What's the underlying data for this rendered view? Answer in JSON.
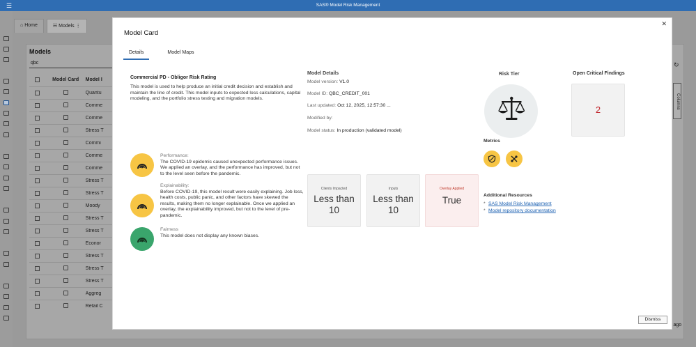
{
  "app": {
    "title": "SAS® Model Risk Management"
  },
  "background": {
    "tabs": [
      {
        "label": "Home"
      },
      {
        "label": "Models"
      }
    ],
    "heading": "Models",
    "search_value": "qbc",
    "table_headers": [
      "Model Card",
      "Model I"
    ],
    "rows": [
      "Quantu",
      "Comme",
      "Comme",
      "Stress T",
      "Commi",
      "Comme",
      "Comme",
      "Stress T",
      "Stress T",
      "Moody",
      "Stress T",
      "Stress T",
      "Econor",
      "Stress T",
      "Stress T",
      "Stress T",
      "Aggreg",
      "Retail C"
    ],
    "columns_label": "Columns",
    "ago_text": "s ago"
  },
  "modal": {
    "title": "Model Card",
    "tabs": [
      {
        "label": "Details"
      },
      {
        "label": "Model Maps"
      }
    ],
    "model_name": "Commercial PD - Obligor Risk Rating",
    "description": "This model is used to help produce an initial credit decision and establish and maintain the line of credit. This model inputs to expected loss calculations, capital modeling, and the portfolio stress testing and migration models.",
    "notes": [
      {
        "title": "Performance:",
        "body": "The COVID-19 epidemic caused unexpected performance issues. We applied an overlay, and the performance has improved, but not to the level seen before the pandemic.",
        "status": "warning"
      },
      {
        "title": "Explainability:",
        "body": "Before COVID-19, this model result were easily explaining. Job loss, health costs, public panic, and other factors have skewed the results, making them no longer explainable. Once we applied an overlay, the explainability improved, but not to the level of pre-pandemic.",
        "status": "warning"
      },
      {
        "title": "Fairness",
        "body": "This model does not display any known biases.",
        "status": "good"
      }
    ],
    "details": {
      "heading": "Model Details",
      "version_label": "Model version:",
      "version": "V1.0",
      "id_label": "Model ID:",
      "id": "QBC_CREDIT_001",
      "updated_label": "Last updated:",
      "updated": "Oct 12, 2025, 12:57:30 ...",
      "modified_label": "Modified by:",
      "modified": "",
      "status_label": "Model status:",
      "status": "In production (validated model)"
    },
    "tiles": [
      {
        "label": "Clients Impacted",
        "value1": "Less than",
        "value2": "10"
      },
      {
        "label": "Inputs",
        "value1": "Less than",
        "value2": "10"
      },
      {
        "label": "Overlay Applied",
        "value1": "True",
        "value2": ""
      }
    ],
    "risk_tier": {
      "heading": "Risk Tier",
      "icon": "scales-icon"
    },
    "metrics": {
      "heading": "Metrics",
      "icons": [
        "shield-check-icon",
        "overlay-icon"
      ]
    },
    "open_findings": {
      "heading": "Open Critical Findings",
      "count": "2"
    },
    "resources": {
      "heading": "Additional Resources",
      "links": [
        {
          "label": "SAS Model Risk Management"
        },
        {
          "label": "Model repository documentation"
        }
      ]
    },
    "dismiss_label": "Dismiss",
    "colors": {
      "accent": "#2f6db3",
      "warning": "#f7c544",
      "good": "#3aa56c",
      "critical": "#c1272d"
    }
  }
}
